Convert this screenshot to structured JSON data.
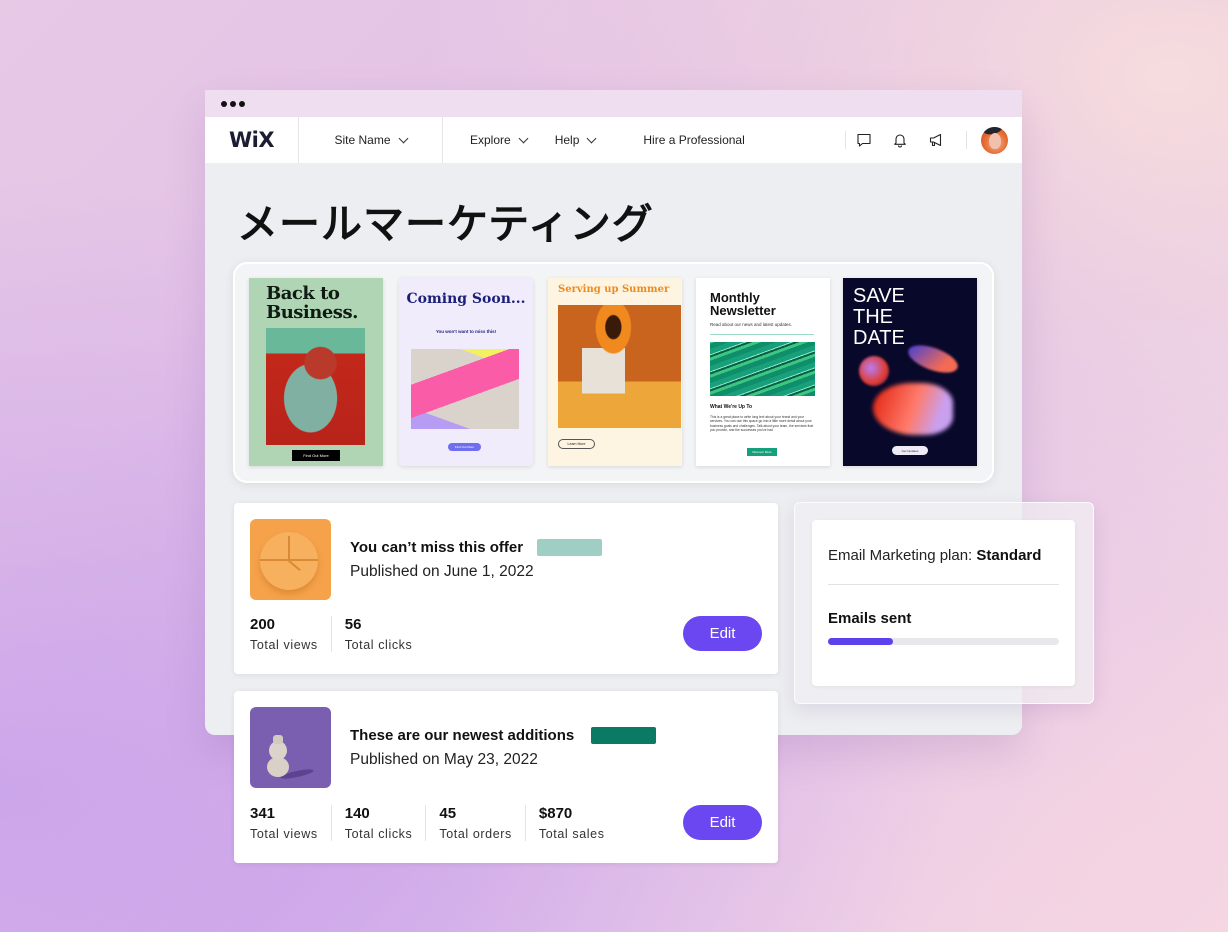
{
  "window": {
    "title_dots": 3
  },
  "navbar": {
    "logo": "WiX",
    "site_name": "Site Name",
    "explore": "Explore",
    "help": "Help",
    "hire": "Hire a Professional",
    "icons": [
      "chat-icon",
      "bell-icon",
      "megaphone-icon"
    ],
    "avatar": "user-avatar"
  },
  "page": {
    "title": "メールマーケティング"
  },
  "templates": [
    {
      "title": "Back to Business.",
      "button": "Find Out More"
    },
    {
      "title": "Coming Soon...",
      "subtitle": "You won't want to miss this!",
      "button": "Find Out More"
    },
    {
      "title": "Serving up Summer",
      "button": "Learn More"
    },
    {
      "title": "Monthly Newsletter",
      "subtitle": "Read about our news and latest updates.",
      "heading": "What We're Up To",
      "body": "This is a great place to write long text about your brand and your services. You can use this space go into a little more detail about your business goals and challenges. Talk about your team, the services that you provide, and the successes you've had",
      "button": "Discover More"
    },
    {
      "title": "SAVE THE DATE",
      "button": "Get Updates"
    }
  ],
  "campaigns": [
    {
      "title": "You can’t miss this offer",
      "date": "Published on June 1, 2022",
      "badge_color": "#9fcfc4",
      "stats": [
        {
          "value": "200",
          "label": "Total views"
        },
        {
          "value": "56",
          "label": "Total clicks"
        }
      ],
      "edit_label": "Edit"
    },
    {
      "title": "These are our newest additions",
      "date": "Published on May 23, 2022",
      "badge_color": "#0a7a62",
      "stats": [
        {
          "value": "341",
          "label": "Total views"
        },
        {
          "value": "140",
          "label": "Total clicks"
        },
        {
          "value": "45",
          "label": "Total orders"
        },
        {
          "value": "$870",
          "label": "Total sales"
        }
      ],
      "edit_label": "Edit"
    }
  ],
  "plan": {
    "label": "Email Marketing plan:",
    "name": "Standard",
    "emails_sent_label": "Emails sent",
    "emails_sent_progress": 0.28
  },
  "colors": {
    "accent": "#6a47f0",
    "progress": "#5b42ea"
  }
}
